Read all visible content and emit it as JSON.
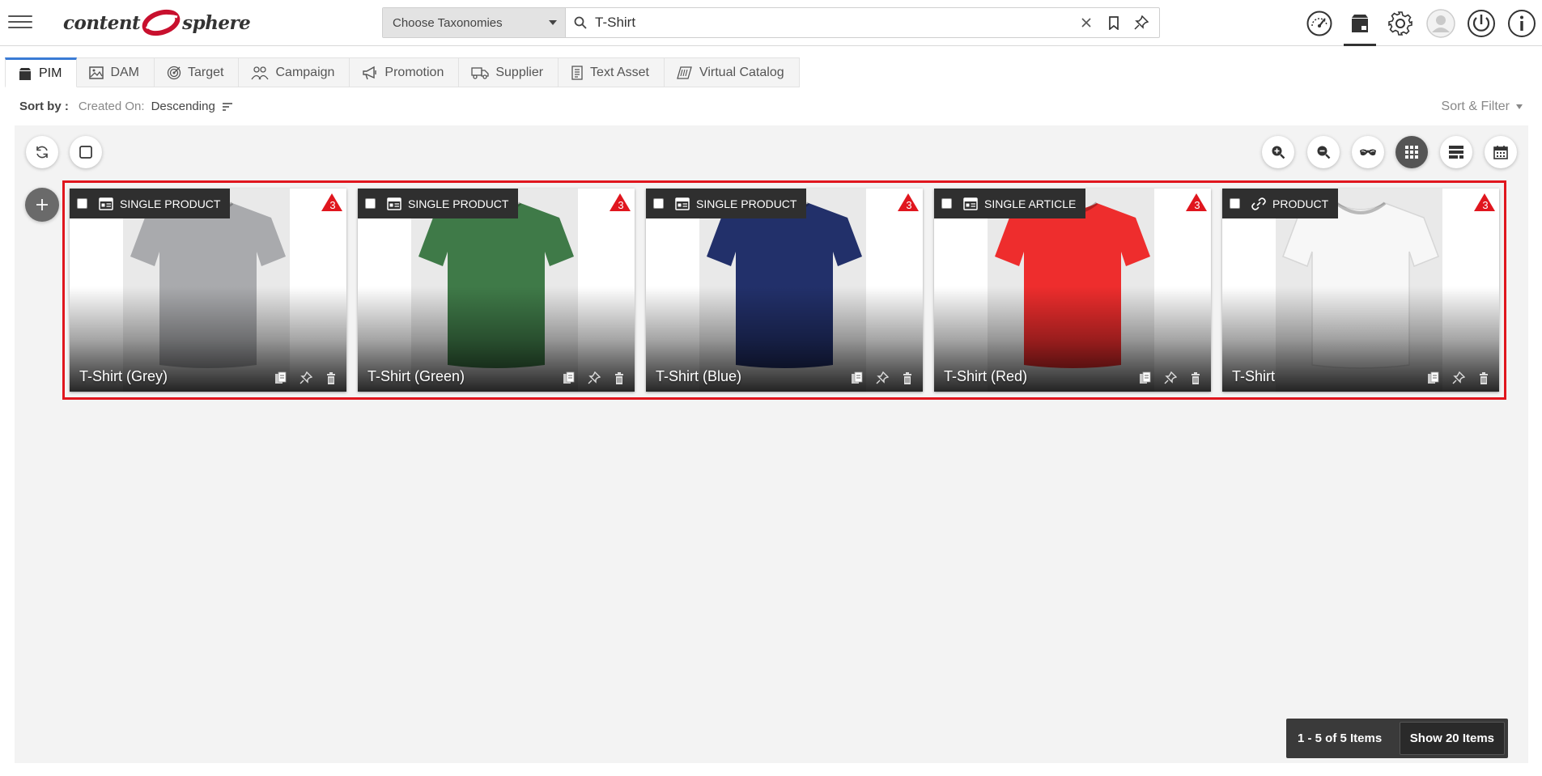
{
  "logo": {
    "word1": "content",
    "word2": "sphere"
  },
  "search": {
    "taxonomy_label": "Choose Taxonomies",
    "query": "T-Shirt"
  },
  "tabs": [
    {
      "label": "PIM",
      "icon": "pim-box-icon",
      "active": true
    },
    {
      "label": "DAM",
      "icon": "image-icon"
    },
    {
      "label": "Target",
      "icon": "target-icon"
    },
    {
      "label": "Campaign",
      "icon": "people-icon"
    },
    {
      "label": "Promotion",
      "icon": "megaphone-icon"
    },
    {
      "label": "Supplier",
      "icon": "truck-icon"
    },
    {
      "label": "Text Asset",
      "icon": "document-icon"
    },
    {
      "label": "Virtual Catalog",
      "icon": "catalog-icon"
    }
  ],
  "sort": {
    "label": "Sort by :",
    "field": "Created On:",
    "direction": "Descending",
    "filter_label": "Sort & Filter"
  },
  "cards": [
    {
      "type": "SINGLE PRODUCT",
      "type_icon": "product-icon",
      "title": "T-Shirt (Grey)",
      "warnings": "3",
      "color": "#a9aaad"
    },
    {
      "type": "SINGLE PRODUCT",
      "type_icon": "product-icon",
      "title": "T-Shirt (Green)",
      "warnings": "3",
      "color": "#3f7a48"
    },
    {
      "type": "SINGLE PRODUCT",
      "type_icon": "product-icon",
      "title": "T-Shirt (Blue)",
      "warnings": "3",
      "color": "#22306a"
    },
    {
      "type": "SINGLE ARTICLE",
      "type_icon": "product-icon",
      "title": "T-Shirt (Red)",
      "warnings": "3",
      "color": "#ee2d2d"
    },
    {
      "type": "PRODUCT",
      "type_icon": "link-icon",
      "title": "T-Shirt",
      "warnings": "3",
      "color": "#f7f7f7"
    }
  ],
  "pager": {
    "count": "1 - 5 of 5 Items",
    "show_label": "Show 20 Items"
  },
  "colors": {
    "accent_tab": "#3a7bd5",
    "highlight": "#e0161e",
    "warning": "#e0161e",
    "logo_red": "#c8102e"
  }
}
